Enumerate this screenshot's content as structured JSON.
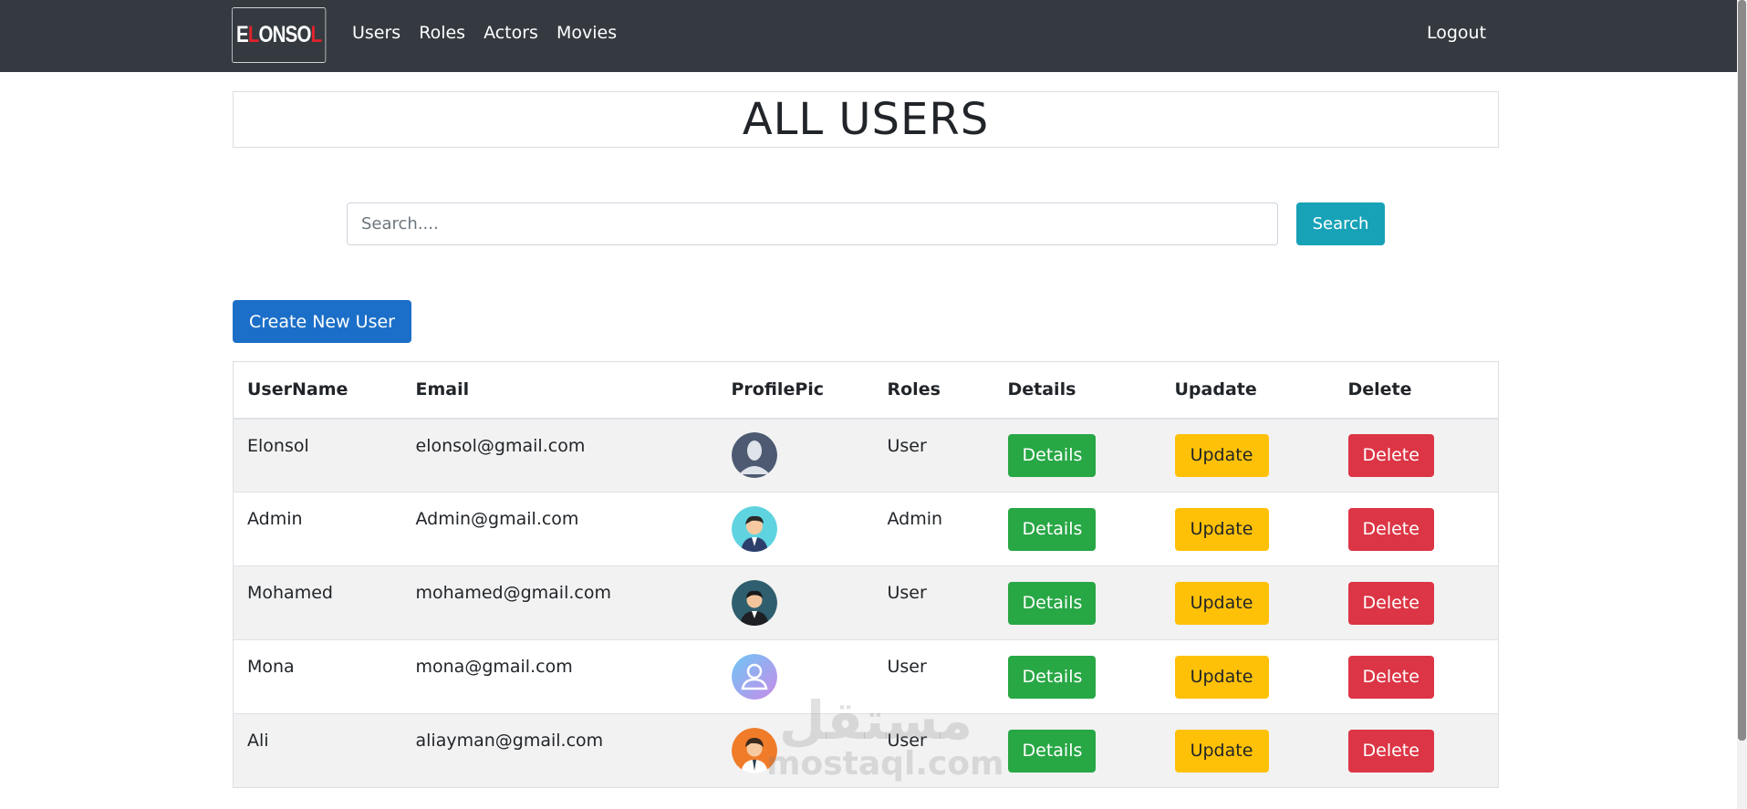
{
  "navbar": {
    "brand": {
      "first": "E",
      "accent": "L",
      "rest": "ONSO",
      "accent2": "L"
    },
    "links": [
      "Users",
      "Roles",
      "Actors",
      "Movies"
    ],
    "logout": "Logout"
  },
  "page": {
    "title": "ALL USERS"
  },
  "search": {
    "placeholder": "Search....",
    "button": "Search"
  },
  "create_button": "Create New User",
  "table": {
    "headers": [
      "UserName",
      "Email",
      "ProfilePic",
      "Roles",
      "Details",
      "Upadate",
      "Delete"
    ],
    "rows": [
      {
        "username": "Elonsol",
        "email": "elonsol@gmail.com",
        "avatar": "default-avatar-icon",
        "role": "User"
      },
      {
        "username": "Admin",
        "email": "Admin@gmail.com",
        "avatar": "businessman-avatar-icon",
        "role": "Admin"
      },
      {
        "username": "Mohamed",
        "email": "mohamed@gmail.com",
        "avatar": "man-suit-avatar-icon",
        "role": "User"
      },
      {
        "username": "Mona",
        "email": "mona@gmail.com",
        "avatar": "user-outline-avatar-icon",
        "role": "User"
      },
      {
        "username": "Ali",
        "email": "aliayman@gmail.com",
        "avatar": "boy-avatar-icon",
        "role": "User"
      }
    ],
    "actions": {
      "details": "Details",
      "update": "Update",
      "delete": "Delete"
    }
  },
  "watermark": {
    "arabic": "مستقل",
    "latin": "mostaql.com"
  },
  "colors": {
    "navbar": "#343a40",
    "primary": "#1c6fc8",
    "info": "#17a2b8",
    "success": "#28a745",
    "warning": "#ffc107",
    "danger": "#dc3545",
    "brand_accent": "#e0222b"
  }
}
